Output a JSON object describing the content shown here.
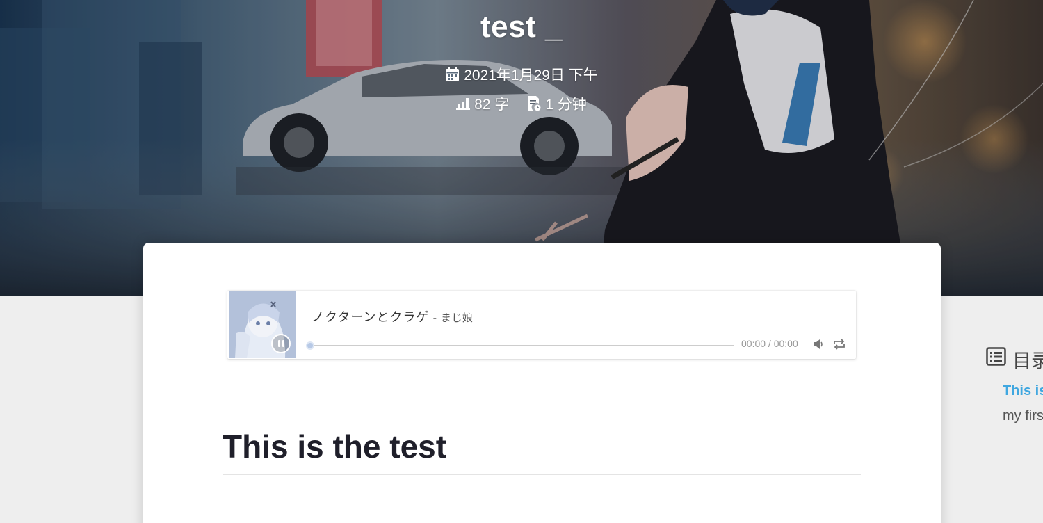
{
  "post": {
    "title": "test _",
    "date": "2021年1月29日 下午",
    "word_count": "82 字",
    "read_time": "1 分钟"
  },
  "icons": {
    "date": "calendar-icon",
    "words": "bar-chart-icon",
    "time": "reading-time-icon",
    "play": "pause-icon",
    "volume": "volume-icon",
    "loop": "loop-icon",
    "toc": "list-icon"
  },
  "player": {
    "song_title": "ノクターンとクラゲ",
    "separator": " - ",
    "artist": "まじ娘",
    "time": "00:00 / 00:00",
    "progress": 0
  },
  "article": {
    "heading": "This is the test"
  },
  "toc": {
    "heading": "目录",
    "items": [
      "This is",
      "my firs"
    ]
  },
  "colors": {
    "accent": "#3fa7e0",
    "heading": "#1f1f2a",
    "page_bg": "#eeeeee"
  }
}
